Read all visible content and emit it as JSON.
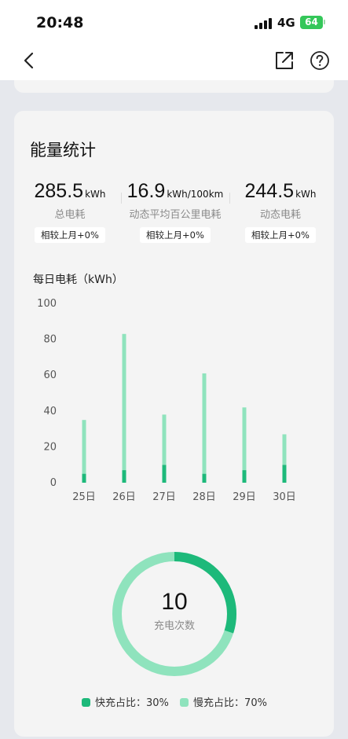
{
  "status_bar": {
    "time": "20:48",
    "network": "4G",
    "battery": "64"
  },
  "colors": {
    "fast": "#1db97a",
    "slow": "#8fe3bd",
    "card_bg": "#f4f4f4",
    "page_bg": "#e6e8ed"
  },
  "icons": {
    "back": "chevron-left-icon",
    "share": "share-external-icon",
    "help": "question-circle-icon"
  },
  "card": {
    "title": "能量统计",
    "stats": [
      {
        "value": "285.5",
        "unit": "kWh",
        "label": "总电耗",
        "badge": "相较上月+0%"
      },
      {
        "value": "16.9",
        "unit": "kWh/100km",
        "label": "动态平均百公里电耗",
        "badge": "相较上月+0%"
      },
      {
        "value": "244.5",
        "unit": "kWh",
        "label": "动态电耗",
        "badge": "相较上月+0%"
      }
    ]
  },
  "chart_data": {
    "type": "bar",
    "title": "每日电耗（kWh）",
    "categories": [
      "25日",
      "26日",
      "27日",
      "28日",
      "29日",
      "30日"
    ],
    "series": [
      {
        "values": [
          5,
          7,
          10,
          5,
          7,
          10
        ],
        "color": "#1db97a"
      },
      {
        "values": [
          30,
          76,
          28,
          56,
          35,
          17
        ],
        "color": "#8fe3bd"
      }
    ],
    "totals": [
      35,
      83,
      38,
      61,
      42,
      27
    ],
    "ylim": [
      0,
      100
    ],
    "yticks": [
      0,
      20,
      40,
      60,
      80,
      100
    ],
    "stacked": true,
    "grid": false
  },
  "charging": {
    "count": "10",
    "count_label": "充电次数",
    "fast_share": 0.3,
    "slow_share": 0.7,
    "legend": [
      {
        "label": "快充占比：30%",
        "color": "#1db97a"
      },
      {
        "label": "慢充占比：70%",
        "color": "#8fe3bd"
      }
    ]
  }
}
